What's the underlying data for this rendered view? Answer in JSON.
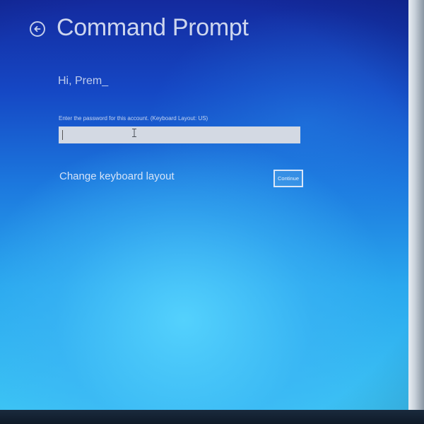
{
  "header": {
    "back_icon": "arrow-left-circle-icon",
    "title": "Command Prompt"
  },
  "greeting": "Hi, Prem_",
  "password_prompt": {
    "label": "Enter the password for this account. (Keyboard Layout: US)",
    "value": ""
  },
  "actions": {
    "change_keyboard_layout": "Change keyboard layout",
    "continue": "Continue"
  },
  "colors": {
    "background_top": "#142a9e",
    "background_bottom": "#3cc4f4",
    "text": "#e1e8f5",
    "input_background": "#d3d9e3"
  }
}
